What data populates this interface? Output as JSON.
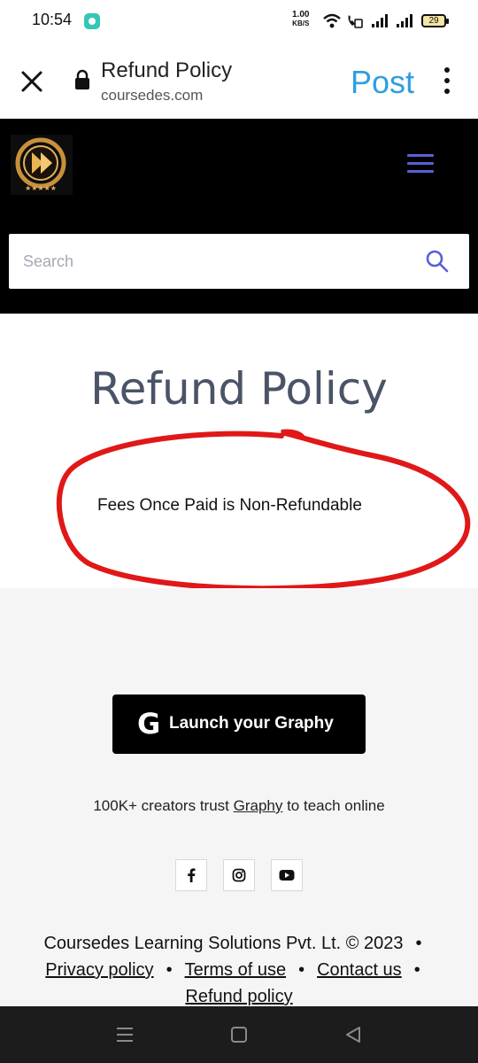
{
  "status_bar": {
    "time": "10:54",
    "speed_value": "1.00",
    "speed_unit": "KB/S",
    "battery": "29"
  },
  "browser": {
    "title": "Refund Policy",
    "domain": "coursedes.com",
    "post_label": "Post"
  },
  "site": {
    "search_placeholder": "Search",
    "accent_color": "#5b5fd4"
  },
  "main": {
    "title": "Refund Policy",
    "policy_text": "Fees Once Paid is Non-Refundable",
    "annotation_color": "#e01818"
  },
  "footer": {
    "launch_icon": "G",
    "launch_label": "Launch your Graphy",
    "trust_prefix": "100K+ creators trust ",
    "trust_link": "Graphy",
    "trust_suffix": " to teach online",
    "social": [
      "facebook-icon",
      "instagram-icon",
      "youtube-icon"
    ],
    "copyright": "Coursedes Learning Solutions Pvt. Lt. © 2023",
    "links": {
      "privacy": "Privacy policy",
      "terms": "Terms of use",
      "contact": "Contact us",
      "refund": "Refund policy"
    }
  }
}
